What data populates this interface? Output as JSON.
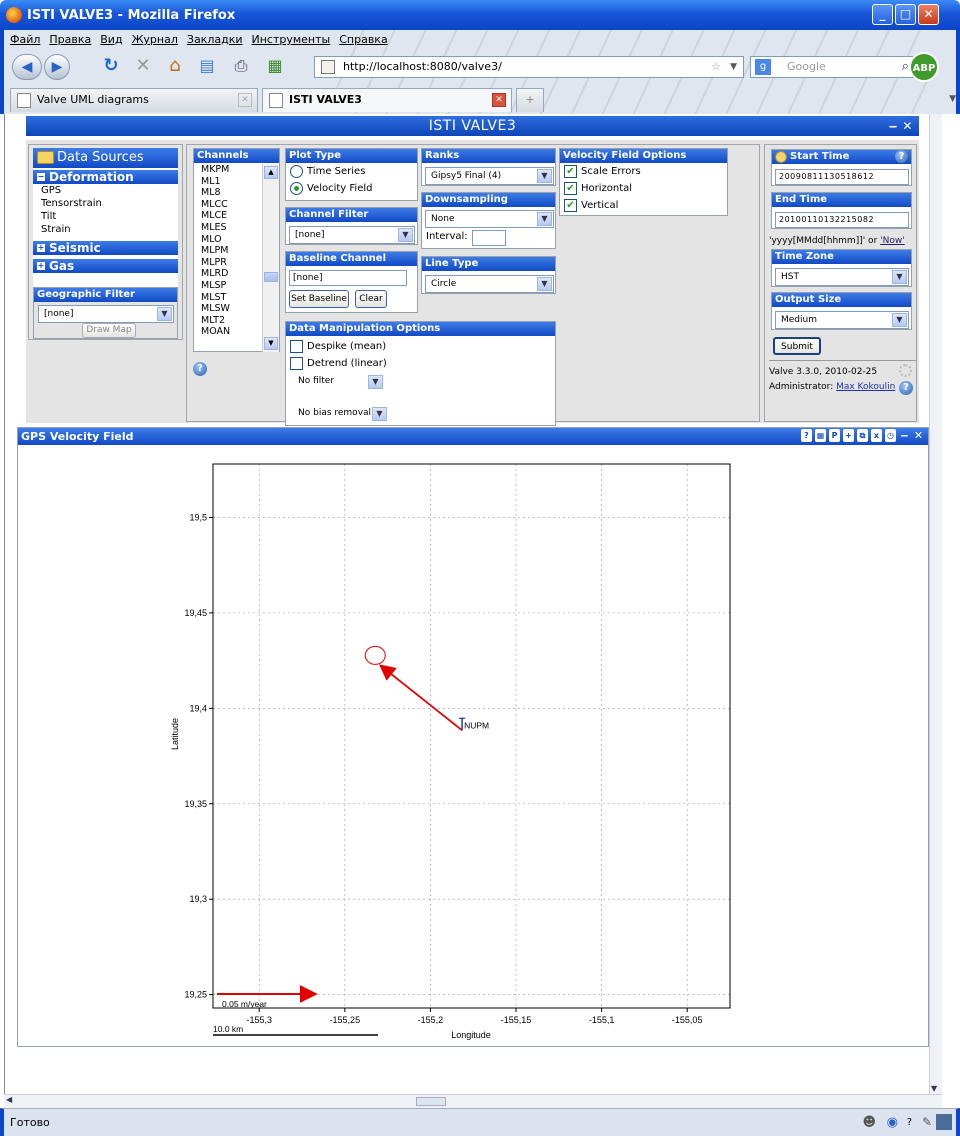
{
  "window": {
    "title": "ISTI VALVE3 - Mozilla Firefox"
  },
  "menu": [
    "Файл",
    "Правка",
    "Вид",
    "Журнал",
    "Закладки",
    "Инструменты",
    "Справка"
  ],
  "url": "http://localhost:8080/valve3/",
  "search_placeholder": "Google",
  "abp": "ABP",
  "tabs": [
    {
      "label": "Valve UML diagrams",
      "active": false
    },
    {
      "label": "ISTI VALVE3",
      "active": true
    }
  ],
  "app": {
    "title": "ISTI VALVE3"
  },
  "data_sources": {
    "title": "Data Sources",
    "sections": [
      {
        "label": "Deformation",
        "expanded": true,
        "items": [
          "GPS",
          "Tensorstrain",
          "Tilt",
          "Strain"
        ]
      },
      {
        "label": "Seismic",
        "expanded": false
      },
      {
        "label": "Gas",
        "expanded": false
      }
    ],
    "geo_filter": {
      "title": "Geographic Filter",
      "value": "[none]",
      "button": "Draw Map"
    }
  },
  "channels": {
    "title": "Channels",
    "items": [
      "MKPM",
      "ML1",
      "ML8",
      "MLCC",
      "MLCE",
      "MLES",
      "MLO",
      "MLPM",
      "MLPR",
      "MLRD",
      "MLSP",
      "MLST",
      "MLSW",
      "MLT2",
      "MOAN"
    ]
  },
  "plot_type": {
    "title": "Plot Type",
    "options": [
      "Time Series",
      "Velocity Field"
    ],
    "selected": "Velocity Field"
  },
  "channel_filter": {
    "title": "Channel Filter",
    "value": "[none]"
  },
  "baseline": {
    "title": "Baseline Channel",
    "value": "[none]",
    "set_button": "Set Baseline",
    "clear_button": "Clear"
  },
  "ranks": {
    "title": "Ranks",
    "value": "Gipsy5 Final (4)"
  },
  "downsampling": {
    "title": "Downsampling",
    "value": "None",
    "interval_label": "Interval:"
  },
  "line_type": {
    "title": "Line Type",
    "value": "Circle"
  },
  "velocity_options": {
    "title": "Velocity Field Options",
    "options": [
      {
        "label": "Scale Errors",
        "checked": true
      },
      {
        "label": "Horizontal",
        "checked": true
      },
      {
        "label": "Vertical",
        "checked": true
      }
    ]
  },
  "data_manipulation": {
    "title": "Data Manipulation Options",
    "despike": "Despike (mean)",
    "detrend": "Detrend (linear)",
    "filter": "No filter",
    "bias": "No bias removal"
  },
  "time": {
    "start_label": "Start Time",
    "start_value": "20090811130518612",
    "end_label": "End Time",
    "end_value": "20100110132215082",
    "hint": "'yyyy[MMdd[hhmm]]' or ",
    "hint_now": "'Now'",
    "tz_label": "Time Zone",
    "tz_value": "HST",
    "size_label": "Output Size",
    "size_value": "Medium",
    "submit": "Submit",
    "version": "Valve 3.3.0, 2010-02-25",
    "admin_label": "Administrator: ",
    "admin_name": "Max Kokoulin"
  },
  "chart_window": {
    "title": "GPS Velocity Field"
  },
  "chart_data": {
    "type": "scatter",
    "xlabel": "Longitude",
    "ylabel": "Latitude",
    "xlim": [
      -155.327,
      -155.025
    ],
    "ylim": [
      19.243,
      19.528
    ],
    "xticks": [
      -155.3,
      -155.25,
      -155.2,
      -155.15,
      -155.1,
      -155.05
    ],
    "xtick_labels": [
      "-155,3",
      "-155,25",
      "-155,2",
      "-155,15",
      "-155,1",
      "-155,05"
    ],
    "yticks": [
      19.25,
      19.3,
      19.35,
      19.4,
      19.45,
      19.5
    ],
    "ytick_labels": [
      "19,25",
      "19,3",
      "19,35",
      "19,4",
      "19,45",
      "19,5"
    ],
    "grid": true,
    "stations": [
      {
        "name": "NUPM",
        "lon": -155.1815,
        "lat": 19.3885,
        "arrow_to_lon": -155.2293,
        "arrow_to_lat": 19.4225,
        "error_ellipse": true
      }
    ],
    "scale_arrow_label": "0.05 m/year",
    "scale_bar_label": "10.0 km"
  },
  "status": {
    "text": "Готово"
  }
}
